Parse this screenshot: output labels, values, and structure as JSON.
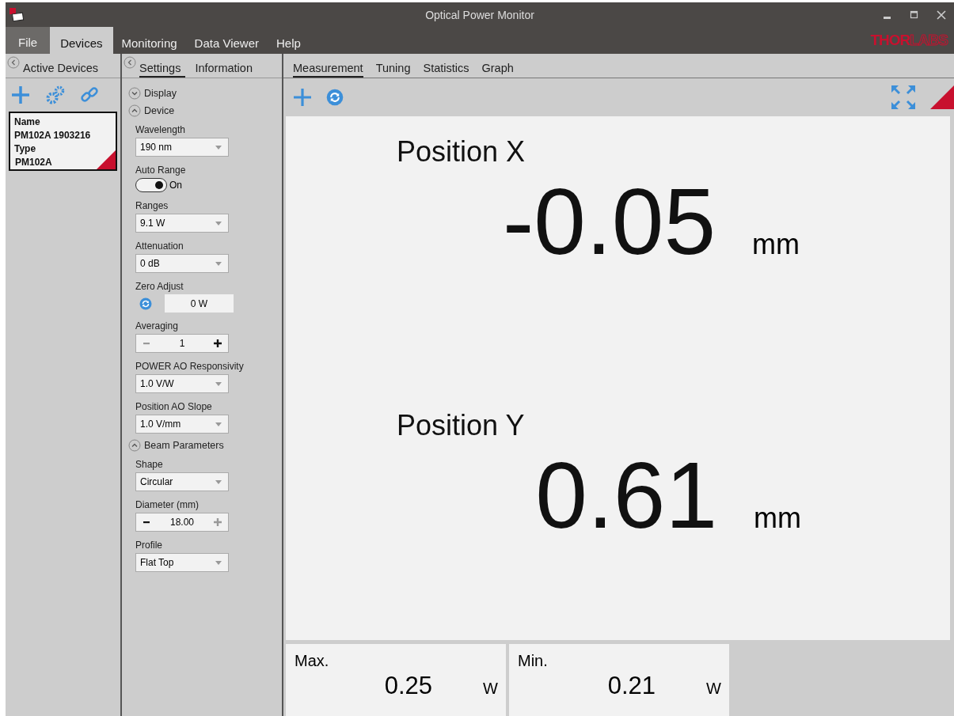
{
  "window": {
    "title": "Optical Power Monitor"
  },
  "menu": [
    {
      "label": "File",
      "selected": false,
      "kind": "file"
    },
    {
      "label": "Devices",
      "selected": true,
      "kind": "menu"
    },
    {
      "label": "Monitoring",
      "selected": false,
      "kind": "menu"
    },
    {
      "label": "Data Viewer",
      "selected": false,
      "kind": "menu"
    },
    {
      "label": "Help",
      "selected": false,
      "kind": "menu"
    }
  ],
  "logo": "**THOR**LABS",
  "devices_panel": {
    "title": "Active Devices",
    "device": {
      "name_label": "Name",
      "name": "PM102A 1903216",
      "type_label": "Type",
      "type": "PM102A"
    }
  },
  "settings_tabs": [
    {
      "label": "Settings",
      "selected": true
    },
    {
      "label": "Information",
      "selected": false
    }
  ],
  "sections": [
    {
      "title": "Display",
      "expanded": false
    },
    {
      "title": "Device",
      "expanded": true,
      "fields": [
        {
          "kind": "dropdown",
          "label": "Wavelength",
          "value": "190 nm"
        },
        {
          "kind": "toggle",
          "label": "Auto Range",
          "on": true,
          "state_text": "On"
        },
        {
          "kind": "dropdown",
          "label": "Ranges",
          "value": "9.1 W"
        },
        {
          "kind": "dropdown",
          "label": "Attenuation",
          "value": "0 dB"
        },
        {
          "kind": "zero",
          "label": "Zero Adjust",
          "value": "0 W"
        },
        {
          "kind": "stepper",
          "label": "Averaging",
          "value": "1",
          "minus_disabled": true,
          "plus_disabled": false
        },
        {
          "kind": "dropdown",
          "label": "POWER AO Responsivity",
          "value": "1.0 V/W"
        },
        {
          "kind": "dropdown",
          "label": "Position AO Slope",
          "value": "1.0 V/mm"
        }
      ]
    },
    {
      "title": "Beam Parameters",
      "expanded": true,
      "fields": [
        {
          "kind": "dropdown",
          "label": "Shape",
          "value": "Circular"
        },
        {
          "kind": "stepper",
          "label": "Diameter (mm)",
          "value": "18.00",
          "minus_disabled": false,
          "plus_disabled": true
        },
        {
          "kind": "dropdown",
          "label": "Profile",
          "value": "Flat Top"
        }
      ]
    }
  ],
  "main_tabs": [
    {
      "label": "Measurement",
      "selected": true
    },
    {
      "label": "Tuning",
      "selected": false
    },
    {
      "label": "Statistics",
      "selected": false
    },
    {
      "label": "Graph",
      "selected": false
    }
  ],
  "readings": [
    {
      "label": "Position X",
      "value": "-0.05",
      "unit": "mm"
    },
    {
      "label": "Position Y",
      "value": "0.61",
      "unit": "mm"
    }
  ],
  "stats": [
    {
      "label": "Max.",
      "value": "0.25",
      "unit": "W"
    },
    {
      "label": "Min.",
      "value": "0.21",
      "unit": "W"
    }
  ]
}
